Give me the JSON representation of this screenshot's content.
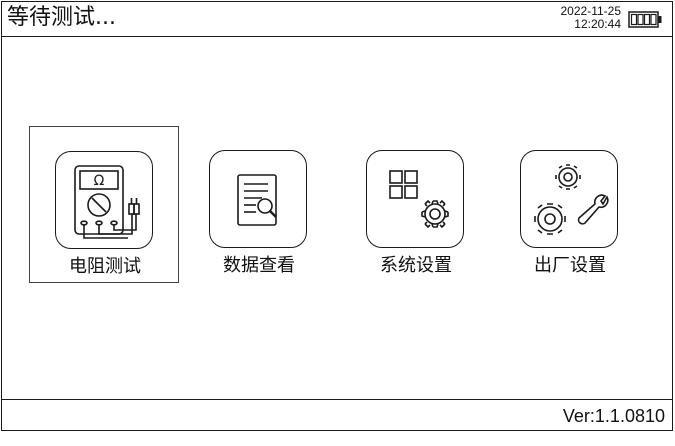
{
  "header": {
    "title": "等待测试...",
    "date": "2022-11-25",
    "time": "12:20:44",
    "battery_icon": "battery-full-icon"
  },
  "menu": {
    "items": [
      {
        "label": "电阻测试",
        "icon": "multimeter-icon",
        "selected": true
      },
      {
        "label": "数据查看",
        "icon": "document-search-icon",
        "selected": false
      },
      {
        "label": "系统设置",
        "icon": "grid-gear-icon",
        "selected": false
      },
      {
        "label": "出厂设置",
        "icon": "gears-wrench-icon",
        "selected": false
      }
    ]
  },
  "footer": {
    "version": "Ver:1.1.0810"
  },
  "colors": {
    "foreground": "#1a1a1a",
    "background": "#ffffff"
  }
}
